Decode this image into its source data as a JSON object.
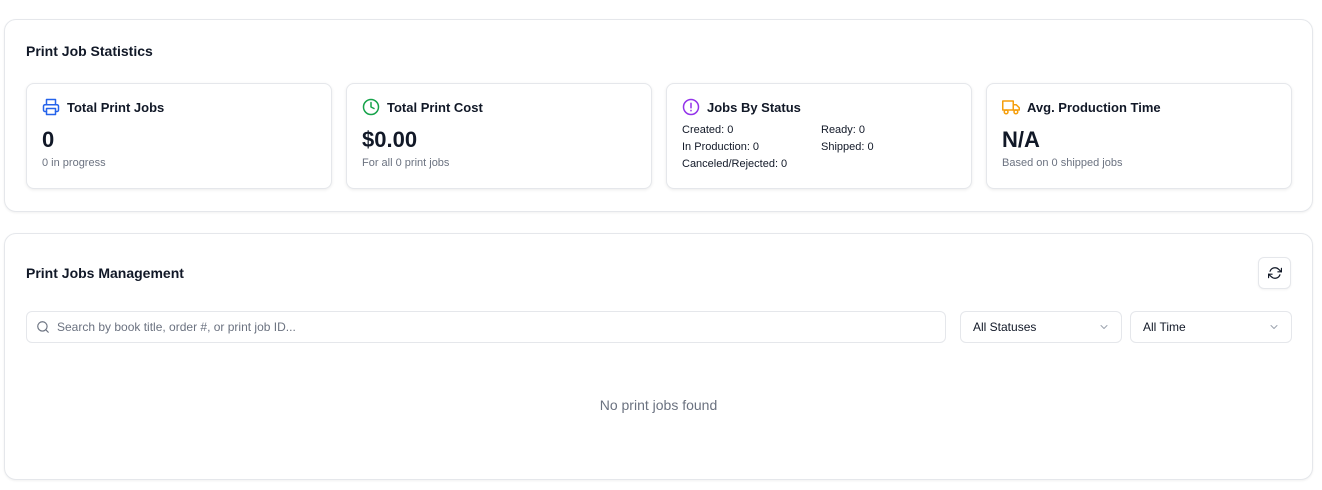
{
  "stats": {
    "title": "Print Job Statistics",
    "cards": [
      {
        "label": "Total Print Jobs",
        "value": "0",
        "sub": "0 in progress",
        "icon": "printer-icon",
        "color": "#2563eb"
      },
      {
        "label": "Total Print Cost",
        "value": "$0.00",
        "sub": "For all 0 print jobs",
        "icon": "clock-icon",
        "color": "#16a34a"
      },
      {
        "label": "Jobs By Status",
        "icon": "alert-circle-icon",
        "color": "#9333ea",
        "status": {
          "created": "Created: 0",
          "ready": "Ready: 0",
          "in_production": "In Production: 0",
          "shipped": "Shipped: 0",
          "canceled": "Canceled/Rejected: 0"
        }
      },
      {
        "label": "Avg. Production Time",
        "value": "N/A",
        "sub": "Based on 0 shipped jobs",
        "icon": "truck-icon",
        "color": "#f59e0b"
      }
    ]
  },
  "jobs": {
    "title": "Print Jobs Management",
    "search_placeholder": "Search by book title, order #, or print job ID...",
    "status_filter": "All Statuses",
    "time_filter": "All Time",
    "empty_message": "No print jobs found"
  }
}
